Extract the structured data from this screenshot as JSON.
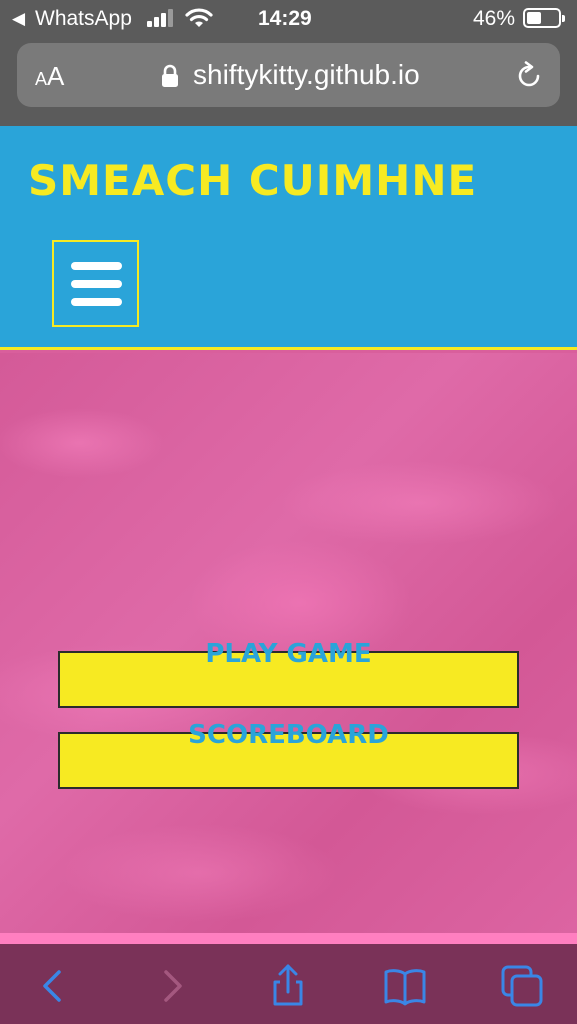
{
  "status_bar": {
    "back_glyph": "◀",
    "app": "WhatsApp",
    "time": "14:29",
    "battery_percent": "46%",
    "battery_level": 0.46,
    "signal_bars": 3
  },
  "address_bar": {
    "aa_label": "AA",
    "url": "shiftykitty.github.io",
    "icons": [
      "lock-icon",
      "reload-icon"
    ]
  },
  "site": {
    "title": "SMEACH CUIMHNE",
    "menu_icon": "hamburger-icon"
  },
  "menu": {
    "play_label": "PLAY GAME",
    "scoreboard_label": "SCOREBOARD"
  },
  "toolbar": {
    "icons": [
      "back-arrow-icon",
      "forward-arrow-icon",
      "share-icon",
      "bookmarks-icon",
      "tabs-icon"
    ]
  },
  "colors": {
    "header_bg": "#2aa4d9",
    "accent_yellow": "#f7ea22",
    "main_pink": "#d95f9c",
    "footer_pink": "#ff7fc0",
    "toolbar_bg": "#7a3258",
    "ios_blue": "#3a86e6"
  }
}
